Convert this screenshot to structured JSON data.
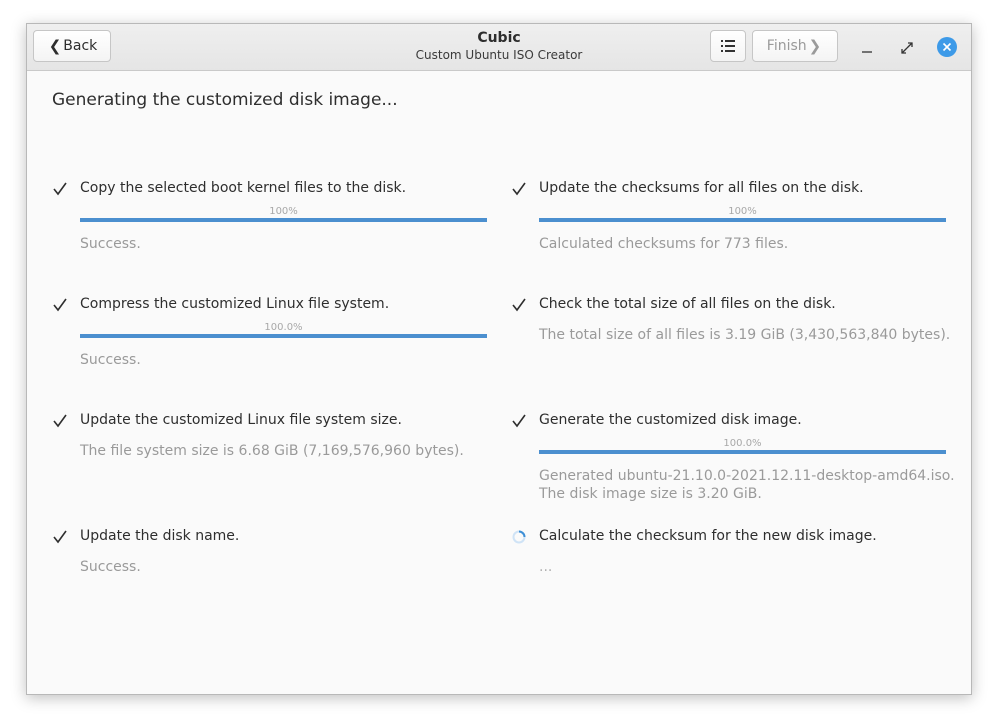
{
  "window": {
    "title": "Cubic",
    "subtitle": "Custom Ubuntu ISO Creator",
    "back_label": "Back",
    "finish_label": "Finish"
  },
  "heading": "Generating the customized disk image...",
  "steps": [
    {
      "label": "Copy the selected boot kernel files to the disk.",
      "percent_text": "100%",
      "progress": 1.0,
      "message": "Success.",
      "status": "done"
    },
    {
      "label": "Update the checksums for all files on the disk.",
      "percent_text": "100%",
      "progress": 1.0,
      "message": "Calculated checksums for 773 files.",
      "status": "done"
    },
    {
      "label": "Compress the customized Linux file system.",
      "percent_text": "100.0%",
      "progress": 1.0,
      "message": "Success.",
      "status": "done"
    },
    {
      "label": "Check the total size of all files on the disk.",
      "message": "The total size of all files is 3.19 GiB (3,430,563,840 bytes).",
      "status": "done"
    },
    {
      "label": "Update the customized Linux file system size.",
      "message": "The file system size is 6.68 GiB (7,169,576,960 bytes).",
      "status": "done"
    },
    {
      "label": "Generate the customized disk image.",
      "percent_text": "100.0%",
      "progress": 1.0,
      "message": "Generated ubuntu-21.10.0-2021.12.11-desktop-amd64.iso.",
      "message2": "The disk image size is 3.20 GiB.",
      "status": "done"
    },
    {
      "label": "Update the disk name.",
      "message": "Success.",
      "status": "done"
    },
    {
      "label": "Calculate the checksum for the new disk image.",
      "message": "...",
      "status": "in-progress"
    }
  ],
  "colors": {
    "accent": "#4b8fcf",
    "close_button": "#3d9ae8",
    "check": "#2e2e2e",
    "muted_text": "#9a9a9a"
  }
}
